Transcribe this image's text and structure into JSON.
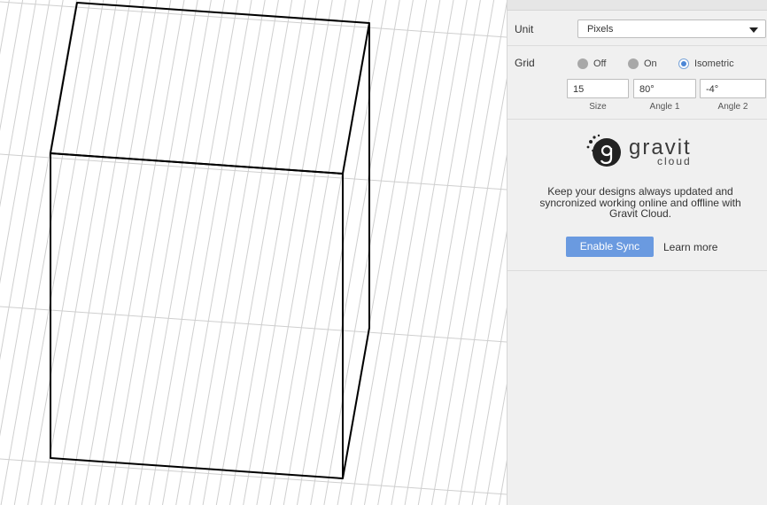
{
  "unit": {
    "label": "Unit",
    "selected": "Pixels"
  },
  "grid": {
    "label": "Grid",
    "options": [
      {
        "label": "Off",
        "selected": false
      },
      {
        "label": "On",
        "selected": false
      },
      {
        "label": "Isometric",
        "selected": true
      }
    ],
    "fields": [
      {
        "value": "15",
        "caption": "Size"
      },
      {
        "value": "80°",
        "caption": "Angle 1"
      },
      {
        "value": "-4°",
        "caption": "Angle 2"
      }
    ]
  },
  "cloud": {
    "logo_text": "gravit",
    "logo_sub": "cloud",
    "message": "Keep your designs always updated and syncronized working online and offline with Gravit Cloud.",
    "enable_button": "Enable Sync",
    "learn_more": "Learn more"
  },
  "colors": {
    "accent": "#6a9ae0",
    "grid_line": "#cfcfcf",
    "shape_stroke": "#000000"
  },
  "icons": {
    "caret": "chevron-down-icon",
    "logo": "gravit-logo-icon"
  }
}
